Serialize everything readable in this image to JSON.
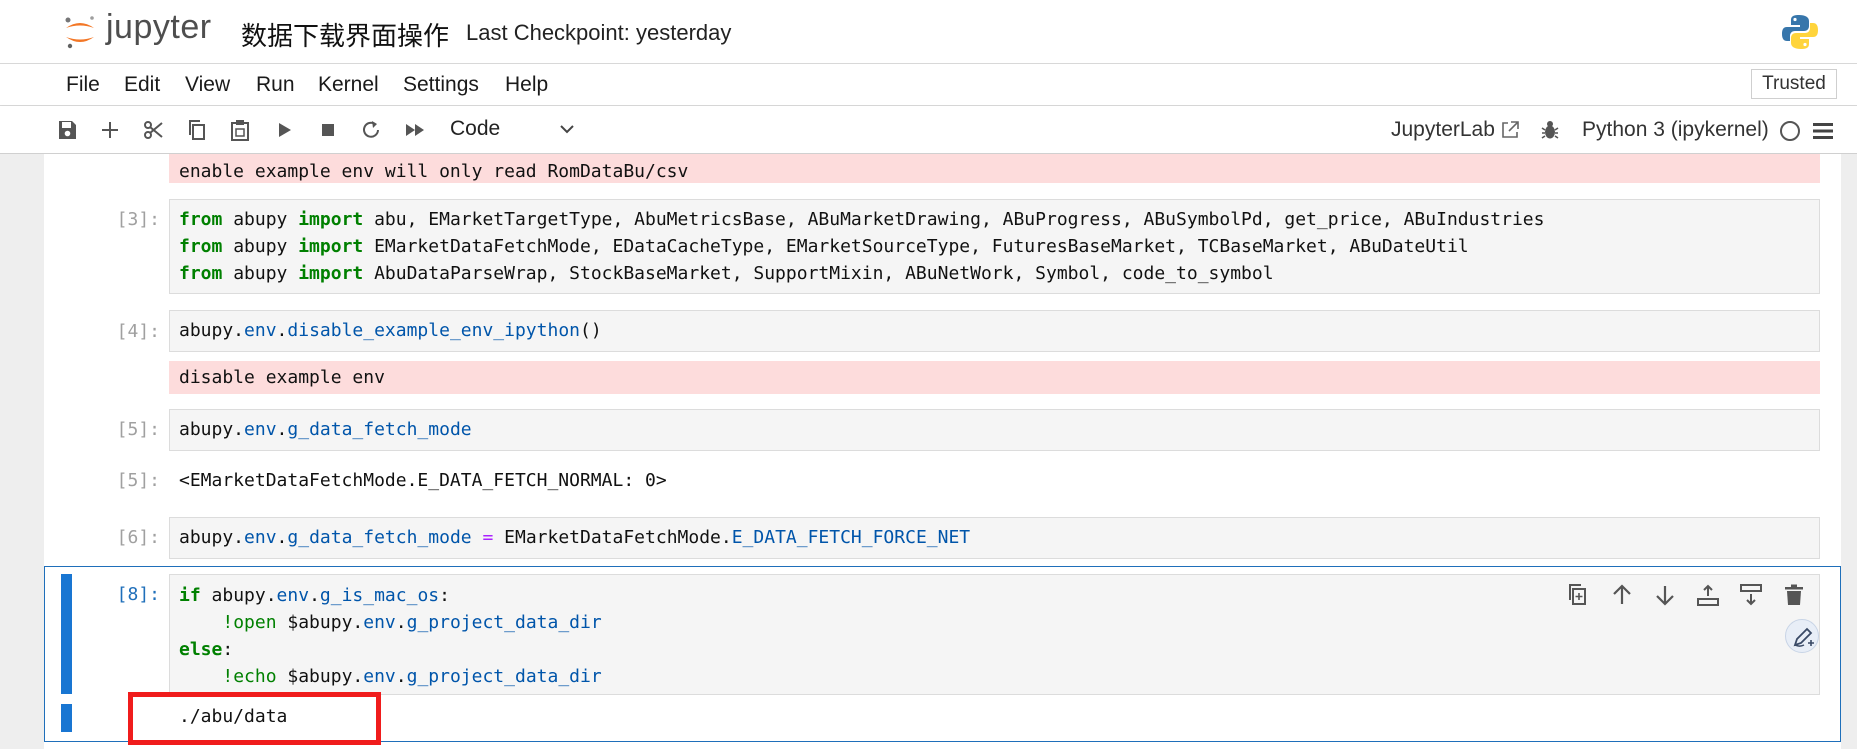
{
  "header": {
    "logo_text": "jupyter",
    "notebook_title": "数据下载界面操作",
    "checkpoint": "Last Checkpoint: yesterday"
  },
  "menu": [
    "File",
    "Edit",
    "View",
    "Run",
    "Kernel",
    "Settings",
    "Help"
  ],
  "trusted_label": "Trusted",
  "toolbar": {
    "cell_type": "Code",
    "jupyterlab_label": "JupyterLab",
    "kernel_name": "Python 3 (ipykernel)"
  },
  "cells": {
    "stderr_top": "enable example env will only read RomDataBu/csv",
    "c3": {
      "prompt": "[3]:",
      "lines": [
        [
          "from",
          " abupy ",
          "import",
          " abu, EMarketTargetType, AbuMetricsBase, ABuMarketDrawing, ABuProgress, ABuSymbolPd, get_price, ABuIndustries"
        ],
        [
          "from",
          " abupy ",
          "import",
          " EMarketDataFetchMode, EDataCacheType, EMarketSourceType, FuturesBaseMarket, TCBaseMarket, ABuDateUtil"
        ],
        [
          "from",
          " abupy ",
          "import",
          " AbuDataParseWrap, StockBaseMarket, SupportMixin, ABuNetWork, Symbol, code_to_symbol"
        ]
      ]
    },
    "c4": {
      "prompt": "[4]:",
      "code": [
        "abupy.",
        "env",
        ".",
        "disable_example_env_ipython",
        "()"
      ],
      "stderr": "disable example env"
    },
    "c5": {
      "prompt": "[5]:",
      "code": [
        "abupy.",
        "env",
        ".",
        "g_data_fetch_mode"
      ],
      "out_prompt": "[5]:",
      "output": "<EMarketDataFetchMode.E_DATA_FETCH_NORMAL: 0>"
    },
    "c6": {
      "prompt": "[6]:",
      "code": [
        "abupy.",
        "env",
        ".",
        "g_data_fetch_mode",
        " = ",
        "EMarketDataFetchMode.",
        "E_DATA_FETCH_FORCE_NET"
      ]
    },
    "c8": {
      "prompt": "[8]:",
      "l1": [
        "if",
        " abupy.",
        "env",
        ".",
        "g_is_mac_os",
        ":"
      ],
      "l2": [
        "    ",
        "!open",
        " $abupy.",
        "env",
        ".",
        "g_project_data_dir"
      ],
      "l3": [
        "else",
        ":"
      ],
      "l4": [
        "    ",
        "!echo",
        " $abupy.",
        "env",
        ".",
        "g_project_data_dir"
      ],
      "output": "./abu/data"
    }
  },
  "colors": {
    "accent": "#1976d2",
    "stderr_bg": "#fddcdc",
    "highlight": "#f01c1c"
  }
}
